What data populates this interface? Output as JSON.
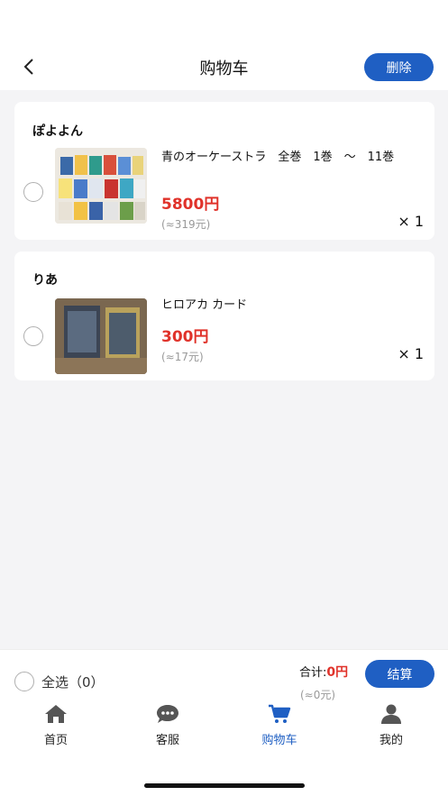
{
  "header": {
    "title": "购物车",
    "delete_label": "删除"
  },
  "cart": {
    "items": [
      {
        "seller": "ぽよよん",
        "title": "青のオーケーストラ　全巻　1巻　～　11巻",
        "price": "5800円",
        "price_cny": "(≈319元)",
        "quantity": "× 1"
      },
      {
        "seller": "りあ",
        "title": "ヒロアカ カード",
        "price": "300円",
        "price_cny": "(≈17元)",
        "quantity": "× 1"
      }
    ]
  },
  "footer": {
    "select_all": "全选（0）",
    "total_label": "合计:",
    "total_value": "0円",
    "total_cny": "(≈0元)",
    "checkout_label": "结算"
  },
  "tabbar": {
    "tabs": [
      {
        "label": "首页",
        "icon": "home-icon"
      },
      {
        "label": "客服",
        "icon": "chat-icon"
      },
      {
        "label": "购物车",
        "icon": "cart-icon"
      },
      {
        "label": "我的",
        "icon": "user-icon"
      }
    ],
    "active_index": 2
  },
  "colors": {
    "accent": "#1f5fc3",
    "price": "#e0322a",
    "muted": "#999999",
    "background": "#f4f4f6"
  }
}
